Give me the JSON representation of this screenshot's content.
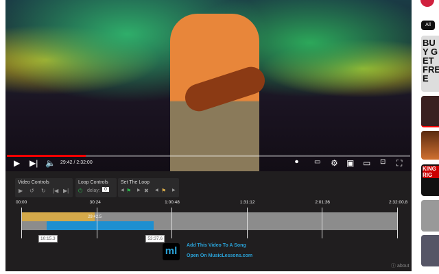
{
  "player": {
    "time": "29:42 / 2:32:00",
    "progress_percent": 19.5
  },
  "panel": {
    "video_controls": {
      "label": "Video Controls"
    },
    "loop_controls": {
      "label": "Loop Controls",
      "delay_label": "delay:",
      "delay_value": "0"
    },
    "set_loop": {
      "label": "Set The Loop"
    }
  },
  "timeline": {
    "ticks": [
      "00:00",
      "30:24",
      "1:00:48",
      "1:31:12",
      "2:01:36",
      "2:32:00.8"
    ],
    "current": "29:42.5",
    "loop_start": "10:15.3",
    "loop_end": "53:37.6",
    "colors": {
      "played": "#d4a94a",
      "loop": "#1e8fd0",
      "track": "#8c8c8c"
    }
  },
  "musiclessons": {
    "logo": "ml",
    "add_link": "Add This Video To A Song",
    "open_link": "Open On MusicLessons.com"
  },
  "about": "about",
  "sidebar": {
    "chip": "All",
    "thumb1_text": "BUY GET FREE",
    "thumb4_text": "KING RIG"
  }
}
